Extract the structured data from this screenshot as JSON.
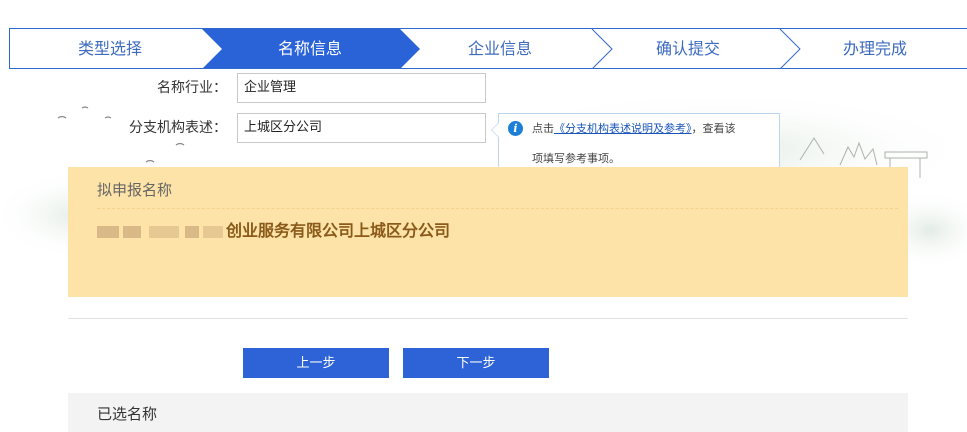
{
  "steps": [
    {
      "label": "类型选择",
      "state": "done"
    },
    {
      "label": "名称信息",
      "state": "active"
    },
    {
      "label": "企业信息",
      "state": "todo"
    },
    {
      "label": "确认提交",
      "state": "todo"
    },
    {
      "label": "办理完成",
      "state": "todo"
    }
  ],
  "form": {
    "industry_label": "名称行业：",
    "industry_value": "企业管理",
    "branch_label": "分支机构表述：",
    "branch_value": "上城区分公司"
  },
  "tip": {
    "prefix": "点击",
    "link": "《分支机构表述说明及参考》",
    "suffix": "，查看该",
    "line2": "项填写参考事项。"
  },
  "proposed": {
    "title": "拟申报名称",
    "name_visible": "创业服务有限公司上城区分公司"
  },
  "buttons": {
    "prev": "上一步",
    "next": "下一步"
  },
  "selected": {
    "title": "已选名称"
  },
  "colors": {
    "accent": "#2d63d6",
    "step_active": "#2a62d8",
    "proposed_bg": "#fde3a8",
    "tip_border": "#bcd6ee"
  }
}
